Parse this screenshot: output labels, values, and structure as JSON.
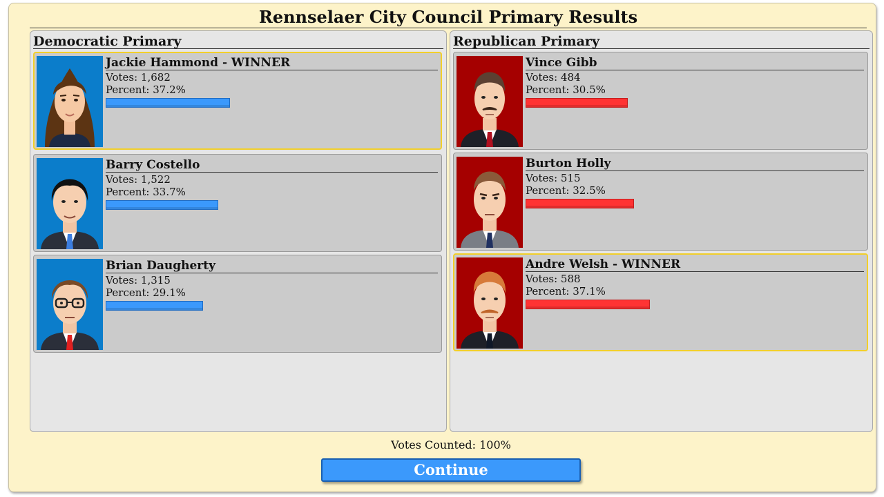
{
  "title": "Rennselaer City Council Primary Results",
  "labels": {
    "votes_prefix": "Votes: ",
    "percent_prefix": "Percent: "
  },
  "colors": {
    "dem_bar": "#3b99fc",
    "rep_bar": "#ff3333",
    "winner_border": "#f2cf2a",
    "dem_portrait_bg": "#0b7dcb",
    "rep_portrait_bg": "#a50000"
  },
  "democratic": {
    "title": "Democratic Primary",
    "candidates": [
      {
        "name": "Jackie Hammond - WINNER",
        "votes": "1,682",
        "percent": "37.2%",
        "share": 0.372,
        "winner": true
      },
      {
        "name": "Barry Costello",
        "votes": "1,522",
        "percent": "33.7%",
        "share": 0.337,
        "winner": false
      },
      {
        "name": "Brian Daugherty",
        "votes": "1,315",
        "percent": "29.1%",
        "share": 0.291,
        "winner": false
      }
    ]
  },
  "republican": {
    "title": "Republican Primary",
    "candidates": [
      {
        "name": "Vince Gibb",
        "votes": "484",
        "percent": "30.5%",
        "share": 0.305,
        "winner": false
      },
      {
        "name": "Burton Holly",
        "votes": "515",
        "percent": "32.5%",
        "share": 0.325,
        "winner": false
      },
      {
        "name": "Andre Welsh - WINNER",
        "votes": "588",
        "percent": "37.1%",
        "share": 0.371,
        "winner": true
      }
    ]
  },
  "footer": {
    "votes_counted": "Votes Counted: 100%",
    "continue_label": "Continue"
  }
}
